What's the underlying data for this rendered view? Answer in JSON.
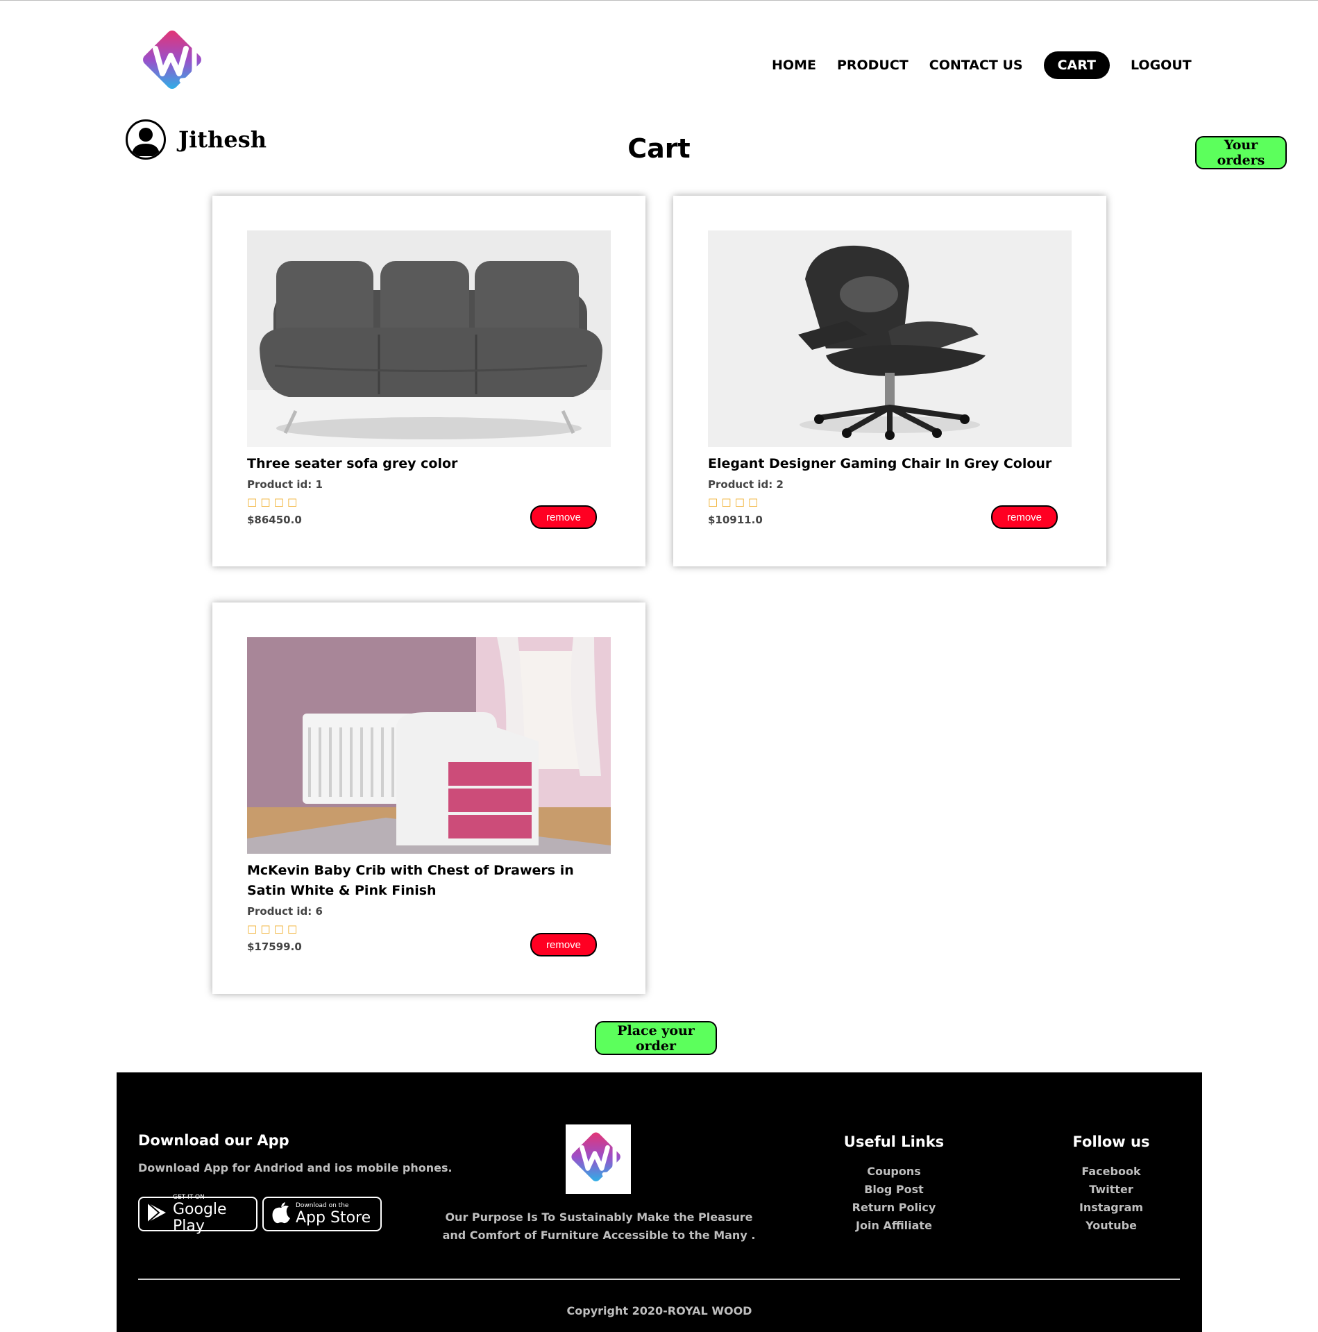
{
  "header": {
    "nav": [
      {
        "label": "HOME",
        "active": false
      },
      {
        "label": "PRODUCT",
        "active": false
      },
      {
        "label": "CONTACT US",
        "active": false
      },
      {
        "label": "CART",
        "active": true
      },
      {
        "label": "LOGOUT",
        "active": false
      }
    ]
  },
  "user": {
    "name": "Jithesh"
  },
  "page": {
    "title": "Cart",
    "orders_button": "Your orders",
    "place_order_button": "Place your order"
  },
  "cart": {
    "items": [
      {
        "name": "Three seater sofa grey color",
        "product_id": "Product id: 1",
        "stars": "☐☐☐☐",
        "price": "$86450.0",
        "remove_label": "remove"
      },
      {
        "name": "Elegant Designer Gaming Chair In Grey Colour",
        "product_id": "Product id: 2",
        "stars": "☐☐☐☐",
        "price": "$10911.0",
        "remove_label": "remove"
      },
      {
        "name": "McKevin Baby Crib with Chest of Drawers in Satin White & Pink Finish",
        "product_id": "Product id: 6",
        "stars": "☐☐☐☐",
        "price": "$17599.0",
        "remove_label": "remove"
      }
    ]
  },
  "footer": {
    "download": {
      "heading": "Download our App",
      "text": "Download App for Andriod and ios mobile phones.",
      "google": {
        "small": "GET IT ON",
        "big": "Google Play"
      },
      "apple": {
        "small": "Download on the",
        "big": "App Store"
      }
    },
    "about": {
      "line1": "Our Purpose Is To Sustainably Make the Pleasure",
      "line2": "and Comfort of Furniture Accessible to the Many ."
    },
    "useful_links": {
      "heading": "Useful Links",
      "items": [
        "Coupons",
        "Blog Post",
        "Return Policy",
        "Join Affiliate"
      ]
    },
    "follow": {
      "heading": "Follow us",
      "items": [
        "Facebook",
        "Twitter",
        "Instagram",
        "Youtube"
      ]
    },
    "copyright": "Copyright 2020-ROYAL WOOD"
  },
  "colors": {
    "accent_green": "#5cff5c",
    "remove_red": "#ff0022",
    "nav_active": "#000000"
  },
  "icons": [
    "brand-logo-icon",
    "user-avatar-icon",
    "star-icon",
    "google-play-icon",
    "apple-icon"
  ]
}
